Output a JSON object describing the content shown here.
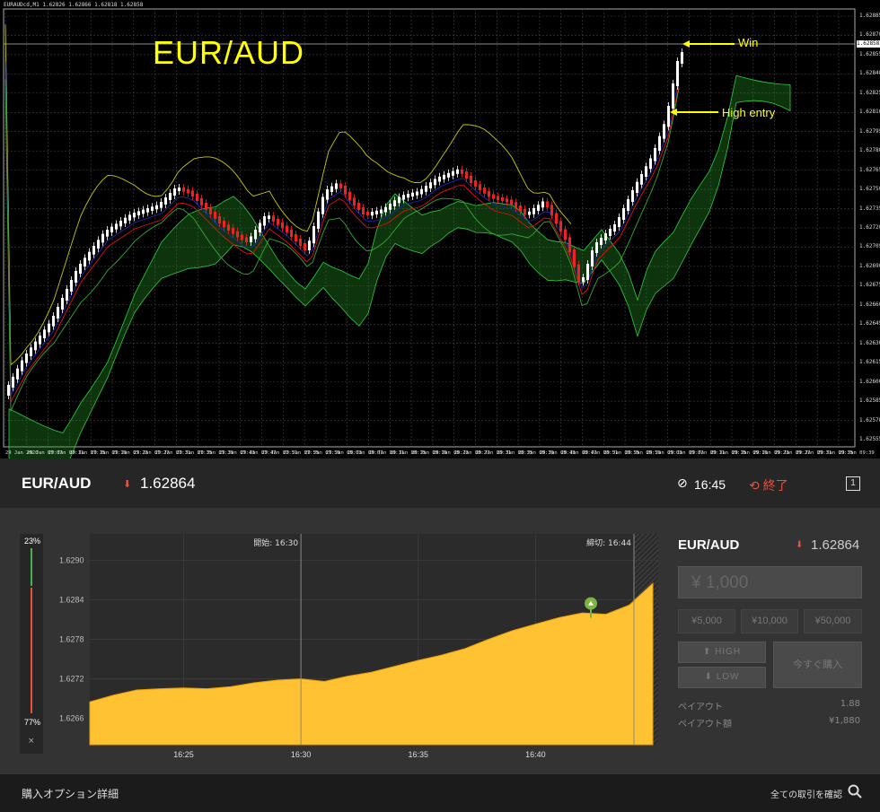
{
  "mt4": {
    "header": "EURAUDcd,M1  1.62826 1.62866 1.62818 1.62858",
    "title": "EUR/AUD",
    "annotations": {
      "win": "Win",
      "entry": "High entry"
    },
    "current_price": "1.62858",
    "y_ticks": [
      "1.62885",
      "1.62870",
      "1.62855",
      "1.62840",
      "1.62825",
      "1.62810",
      "1.62795",
      "1.62780",
      "1.62765",
      "1.62750",
      "1.62735",
      "1.62720",
      "1.62705",
      "1.62690",
      "1.62675",
      "1.62660",
      "1.62645",
      "1.62630",
      "1.62615",
      "1.62600",
      "1.62585",
      "1.62570",
      "1.62555"
    ],
    "x_ticks": [
      "29 Jan 2020",
      "29 Jan 07:07",
      "29 Jan 07:11",
      "29 Jan 07:15",
      "29 Jan 07:19",
      "29 Jan 07:23",
      "29 Jan 07:27",
      "29 Jan 07:31",
      "29 Jan 07:35",
      "29 Jan 07:39",
      "29 Jan 07:43",
      "29 Jan 07:47",
      "29 Jan 07:51",
      "29 Jan 07:55",
      "29 Jan 07:59",
      "29 Jan 08:03",
      "29 Jan 08:07",
      "29 Jan 08:11",
      "29 Jan 08:15",
      "29 Jan 08:19",
      "29 Jan 08:23",
      "29 Jan 08:27",
      "29 Jan 08:31",
      "29 Jan 08:35",
      "29 Jan 08:39",
      "29 Jan 08:43",
      "29 Jan 08:47",
      "29 Jan 08:51",
      "29 Jan 08:55",
      "29 Jan 08:59",
      "29 Jan 09:03",
      "29 Jan 09:07",
      "29 Jan 09:11",
      "29 Jan 09:15",
      "29 Jan 09:19",
      "29 Jan 09:23",
      "29 Jan 09:27",
      "29 Jan 09:31",
      "29 Jan 09:35",
      "29 Jan 09:39"
    ]
  },
  "header": {
    "pair": "EUR/AUD",
    "direction_icon": "down-arrow-icon",
    "price": "1.62864",
    "time": "16:45",
    "end_label": "終了",
    "expand_label": "1"
  },
  "ratio": {
    "high_pct": "23%",
    "low_pct": "77%",
    "close": "×"
  },
  "chart_data": {
    "type": "area",
    "y_ticks": [
      "1.6290",
      "1.6284",
      "1.6278",
      "1.6272",
      "1.6266"
    ],
    "x_ticks": [
      "16:25",
      "16:30",
      "16:35",
      "16:40"
    ],
    "ylim": [
      1.6262,
      1.6294
    ],
    "start_label": "開始: 16:30",
    "cutoff_label": "締切: 16:44",
    "fill": "#ffc233",
    "x": [
      "16:21",
      "16:22",
      "16:23",
      "16:24",
      "16:25",
      "16:26",
      "16:27",
      "16:28",
      "16:29",
      "16:30",
      "16:31",
      "16:32",
      "16:33",
      "16:34",
      "16:35",
      "16:36",
      "16:37",
      "16:38",
      "16:39",
      "16:40",
      "16:41",
      "16:42",
      "16:43",
      "16:44",
      "16:45"
    ],
    "values": [
      1.62685,
      1.62695,
      1.62703,
      1.62705,
      1.62706,
      1.62705,
      1.62708,
      1.62714,
      1.62718,
      1.6272,
      1.62716,
      1.62724,
      1.6273,
      1.62739,
      1.62748,
      1.62756,
      1.62766,
      1.6278,
      1.62793,
      1.62803,
      1.62813,
      1.6282,
      1.62818,
      1.62832,
      1.62865
    ]
  },
  "panel": {
    "pair": "EUR/AUD",
    "price": "1.62864",
    "amount_placeholder": "¥ 1,000",
    "quick": [
      "¥5,000",
      "¥10,000",
      "¥50,000"
    ],
    "high": "HIGH",
    "low": "LOW",
    "buy": "今すぐ購入",
    "payout_label": "ペイアウト",
    "payout_value": "1.88",
    "payout_amount_label": "ペイアウト額",
    "payout_amount_value": "¥1,880"
  },
  "footer": {
    "left": "購入オプション詳細",
    "right": "全ての取引を確認"
  }
}
